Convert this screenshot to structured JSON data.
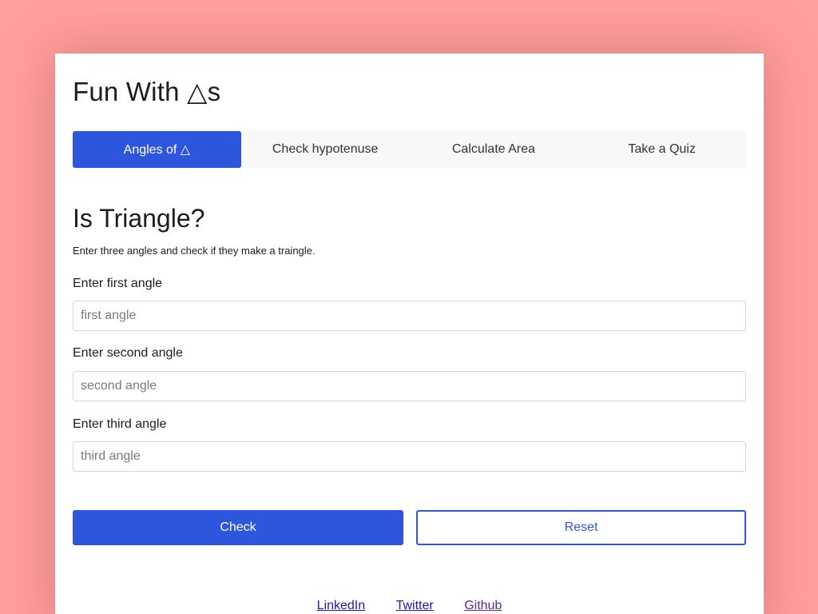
{
  "app": {
    "title": "Fun With △s"
  },
  "tabs": [
    {
      "label": "Angles of △",
      "active": true
    },
    {
      "label": "Check hypotenuse",
      "active": false
    },
    {
      "label": "Calculate Area",
      "active": false
    },
    {
      "label": "Take a Quiz",
      "active": false
    }
  ],
  "section": {
    "title": "Is Triangle?",
    "description": "Enter three angles and check if they make a traingle."
  },
  "fields": [
    {
      "label": "Enter first angle",
      "placeholder": "first angle",
      "value": ""
    },
    {
      "label": "Enter second angle",
      "placeholder": "second angle",
      "value": ""
    },
    {
      "label": "Enter third angle",
      "placeholder": "third angle",
      "value": ""
    }
  ],
  "actions": {
    "check_label": "Check",
    "reset_label": "Reset"
  },
  "footer": {
    "links": [
      {
        "label": "LinkedIn"
      },
      {
        "label": "Twitter"
      },
      {
        "label": "Github"
      }
    ]
  },
  "colors": {
    "background": "#ff9f9c",
    "accent": "#2d56dd",
    "tab_bar": "#f8f8f9",
    "link": "#1d1ab8",
    "link_visited": "#5b2a86"
  }
}
